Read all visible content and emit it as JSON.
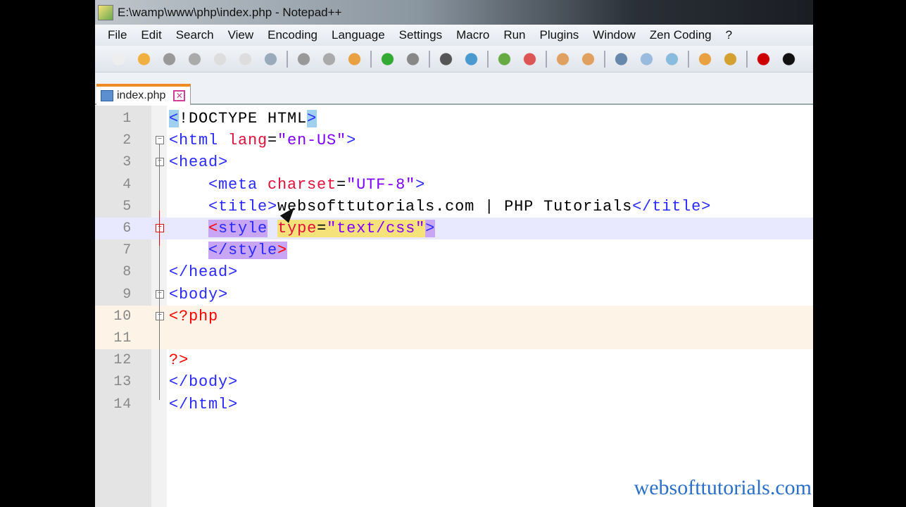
{
  "title": "E:\\wamp\\www\\php\\index.php - Notepad++",
  "menu": [
    "File",
    "Edit",
    "Search",
    "View",
    "Encoding",
    "Language",
    "Settings",
    "Macro",
    "Run",
    "Plugins",
    "Window",
    "Zen Coding",
    "?"
  ],
  "tab": {
    "label": "index.php",
    "close": "✕"
  },
  "toolbar_icons": [
    "new",
    "open",
    "save",
    "save-all",
    "close",
    "close-all",
    "print",
    "cut",
    "copy",
    "paste",
    "undo",
    "redo",
    "find",
    "replace",
    "zoom-in",
    "zoom-out",
    "sync-v",
    "sync-h",
    "wrap",
    "all-chars",
    "indent-guide",
    "udl",
    "doc-map",
    "record",
    "stop"
  ],
  "lines": [
    {
      "n": "1",
      "tokens": [
        [
          "<",
          "t hb"
        ],
        [
          "!DOCTYPE HTML",
          "k"
        ],
        [
          ">",
          "t hb"
        ]
      ]
    },
    {
      "n": "2",
      "tokens": [
        [
          "<html ",
          "t"
        ],
        [
          "lang",
          "a"
        ],
        [
          "=",
          "k"
        ],
        [
          "\"en-US\"",
          "v"
        ],
        [
          ">",
          "t"
        ]
      ]
    },
    {
      "n": "3",
      "tokens": [
        [
          "<head>",
          "t"
        ]
      ]
    },
    {
      "n": "4",
      "tokens": [
        [
          "    <meta ",
          "t"
        ],
        [
          "charset",
          "a"
        ],
        [
          "=",
          "k"
        ],
        [
          "\"UTF-8\"",
          "v"
        ],
        [
          ">",
          "t"
        ]
      ]
    },
    {
      "n": "5",
      "tokens": [
        [
          "    <title>",
          "t"
        ],
        [
          "websofttutorials.com | PHP Tutorials",
          "k"
        ],
        [
          "</title>",
          "t"
        ]
      ]
    },
    {
      "n": "6",
      "tokens": [
        [
          "    ",
          "k"
        ],
        [
          "<",
          "p hs"
        ],
        [
          "style",
          "t hs"
        ],
        [
          " ",
          "k"
        ],
        [
          "type",
          "a hy"
        ],
        [
          "=",
          "k hy"
        ],
        [
          "\"text/css\"",
          "v hy"
        ],
        [
          ">",
          "t hs"
        ]
      ]
    },
    {
      "n": "7",
      "tokens": [
        [
          "    ",
          "k"
        ],
        [
          "</style",
          "t hs"
        ],
        [
          ">",
          "p hs"
        ]
      ]
    },
    {
      "n": "8",
      "tokens": [
        [
          "</head>",
          "t"
        ]
      ]
    },
    {
      "n": "9",
      "tokens": [
        [
          "<body>",
          "t"
        ]
      ]
    },
    {
      "n": "10",
      "tokens": [
        [
          "<?php",
          "p"
        ]
      ]
    },
    {
      "n": "11",
      "tokens": []
    },
    {
      "n": "12",
      "tokens": [
        [
          "?>",
          "p"
        ]
      ]
    },
    {
      "n": "13",
      "tokens": [
        [
          "</body>",
          "t"
        ]
      ]
    },
    {
      "n": "14",
      "tokens": [
        [
          "</html>",
          "t"
        ]
      ]
    }
  ],
  "watermark": "websofttutorials.com"
}
